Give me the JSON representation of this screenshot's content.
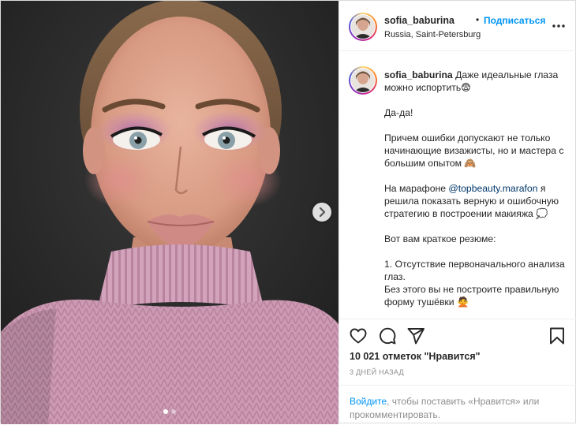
{
  "post": {
    "username": "sofia_baburina",
    "separator": "•",
    "follow_label": "Подписаться",
    "location": "Russia, Saint-Petersburg"
  },
  "caption": {
    "username": "sofia_baburina",
    "paragraphs": [
      "Даже идеальные глаза можно испортить😨",
      "Да-да!",
      "Причем ошибки допускают не только начинающие визажисты, но и мастера с большим опытом 🙈"
    ],
    "marathon_prefix": "На марафоне ",
    "marathon_mention": "@topbeauty.marafon",
    "marathon_suffix": " я решила показать верную и ошибочную стратегию в построении макияжа 💭",
    "summary_intro": "Вот вам краткое резюме:",
    "point_1_title": "1. Отсутствие первоначального анализа глаз.",
    "point_1_body": "Без этого вы не построите правильную форму тушёвки 🙅"
  },
  "stats": {
    "likes": "10 021 отметок \"Нравится\"",
    "time_ago": "3 ДНЕЙ НАЗАД"
  },
  "login_prompt": {
    "link": "Войдите",
    "rest": ", чтобы поставить «Нравится» или прокомментировать."
  },
  "carousel": {
    "total_slides": 2,
    "current_slide": 1
  },
  "icons": {
    "next": "chevron-right-icon",
    "more": "more-options-icon",
    "like": "heart-icon",
    "comment": "comment-icon",
    "share": "paper-plane-icon",
    "save": "bookmark-icon"
  },
  "colors": {
    "link_blue": "#0095f6",
    "mention_blue": "#00376b",
    "muted_gray": "#8e8e8e",
    "text": "#262626"
  }
}
